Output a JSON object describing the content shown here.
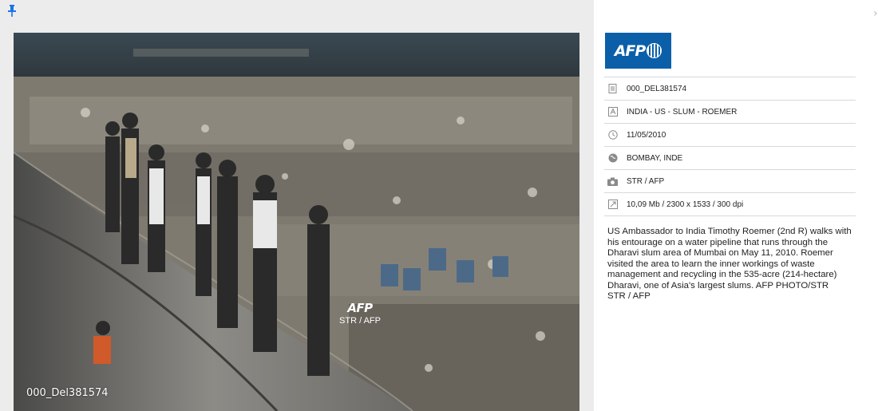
{
  "pin": {
    "icon": "pin-icon"
  },
  "photo": {
    "id_label": "000_Del381574",
    "watermark_logo": "AFP",
    "watermark_credit": "STR / AFP"
  },
  "panel": {
    "logo_text": "AFP",
    "meta": [
      {
        "icon": "document-id-icon",
        "text": "000_DEL381574"
      },
      {
        "icon": "title-icon",
        "text": "INDIA - US - SLUM - ROEMER"
      },
      {
        "icon": "clock-icon",
        "text": "11/05/2010"
      },
      {
        "icon": "globe-icon",
        "text": "BOMBAY, INDE"
      },
      {
        "icon": "camera-icon",
        "text": "STR / AFP"
      },
      {
        "icon": "resize-icon",
        "text": "10,09 Mb / 2300 x 1533 / 300 dpi"
      }
    ],
    "caption": "US Ambassador to India Timothy Roemer (2nd R) walks with his entourage on a water pipeline that runs through the Dharavi slum area of Mumbai on May 11, 2010. Roemer visited the area to learn the inner workings of waste management and recycling in the 535-acre (214-hectare) Dharavi, one of Asia's largest slums. AFP PHOTO/STR",
    "caption_credit": "STR / AFP"
  },
  "colors": {
    "accent": "#1a73e8",
    "afp_blue": "#0b5fa8",
    "divider": "#d8d8d8"
  }
}
